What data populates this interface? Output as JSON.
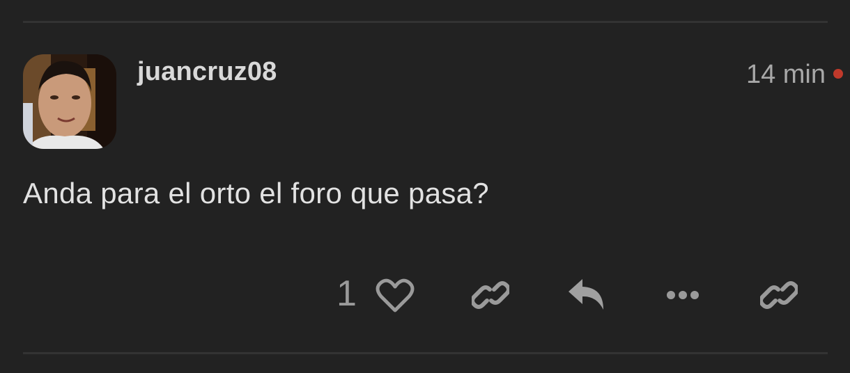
{
  "post": {
    "username": "juancruz08",
    "timestamp": "14 min",
    "body": "Anda para el orto el foro que pasa?",
    "unread_color": "#c0392b"
  },
  "actions": {
    "like_count": "1",
    "icons": [
      "heart-icon",
      "link-icon",
      "reply-icon",
      "more-icon",
      "link-icon"
    ]
  }
}
